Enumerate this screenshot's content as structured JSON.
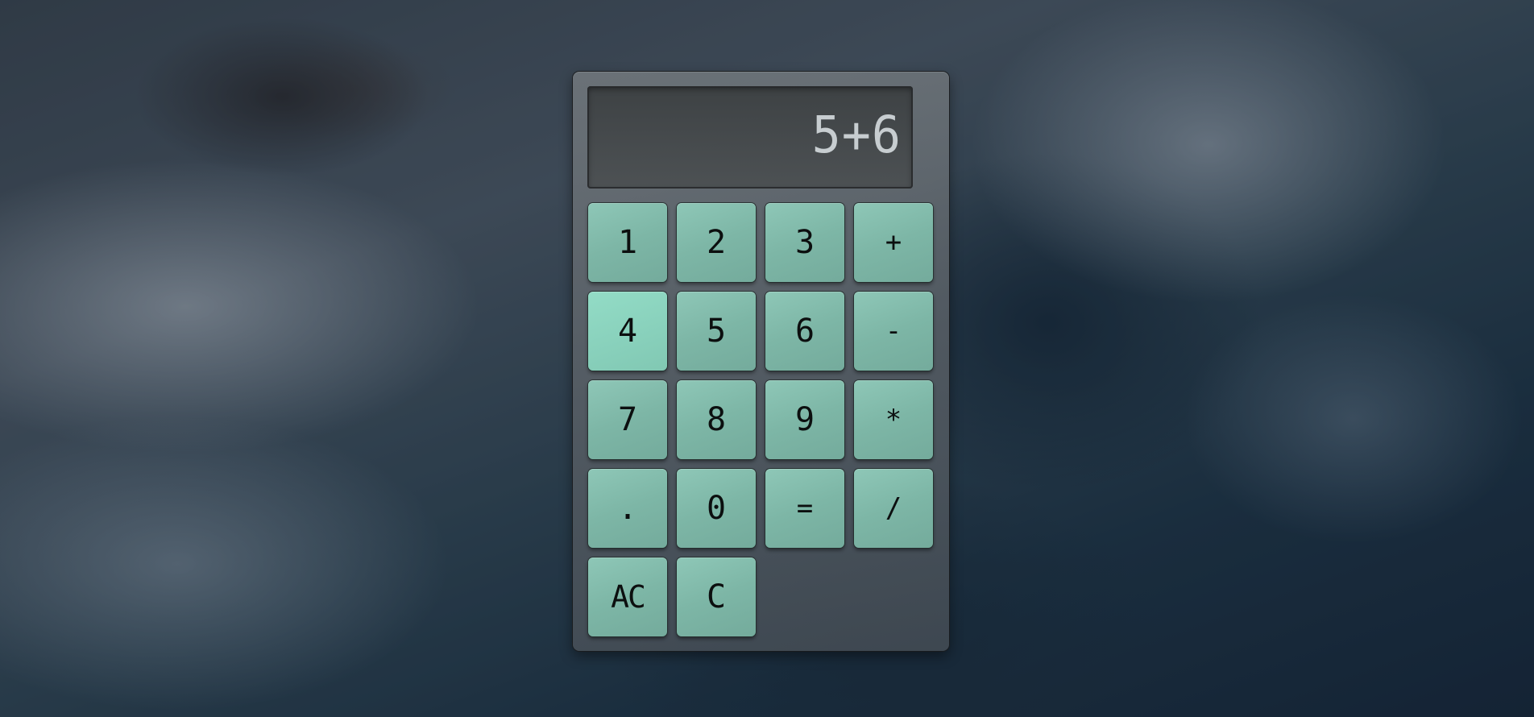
{
  "display": {
    "value": "5+6"
  },
  "keys": [
    {
      "label": "1",
      "name": "key-1"
    },
    {
      "label": "2",
      "name": "key-2"
    },
    {
      "label": "3",
      "name": "key-3"
    },
    {
      "label": "+",
      "name": "key-plus"
    },
    {
      "label": "4",
      "name": "key-4"
    },
    {
      "label": "5",
      "name": "key-5"
    },
    {
      "label": "6",
      "name": "key-6"
    },
    {
      "label": "-",
      "name": "key-minus"
    },
    {
      "label": "7",
      "name": "key-7"
    },
    {
      "label": "8",
      "name": "key-8"
    },
    {
      "label": "9",
      "name": "key-9"
    },
    {
      "label": "*",
      "name": "key-multiply"
    },
    {
      "label": ".",
      "name": "key-decimal"
    },
    {
      "label": "0",
      "name": "key-0"
    },
    {
      "label": "=",
      "name": "key-equals"
    },
    {
      "label": "/",
      "name": "key-divide"
    },
    {
      "label": "AC",
      "name": "key-all-clear"
    },
    {
      "label": "C",
      "name": "key-clear"
    }
  ],
  "colors": {
    "key": "#7db6a6",
    "key_highlight": "#88d0bb",
    "display_bg": "#3e4244",
    "display_text": "#c7cdd0"
  }
}
